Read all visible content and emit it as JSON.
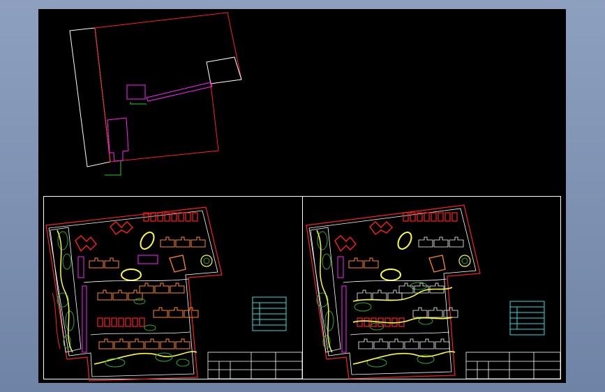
{
  "app": {
    "frame_gradient": [
      "#8ea0bf",
      "#6f83a6"
    ],
    "model_space_background": "#000000"
  },
  "colors": {
    "boundary": "#ff2020",
    "outline": "#ffffff",
    "magenta": "#ff22ff",
    "green": "#22d322",
    "yellow": "#ffff33",
    "orange": "#ff8a1e",
    "cyan": "#33dddd",
    "tree": "#2fa82f"
  },
  "drawings": {
    "site_outline_sketch": {
      "layer_colors": [
        "white",
        "red",
        "magenta",
        "green"
      ]
    },
    "layout_sheet_left": {
      "title_block": "blank",
      "legend": "cyan"
    },
    "layout_sheet_right": {
      "title_block": "blank",
      "legend": "cyan"
    }
  }
}
